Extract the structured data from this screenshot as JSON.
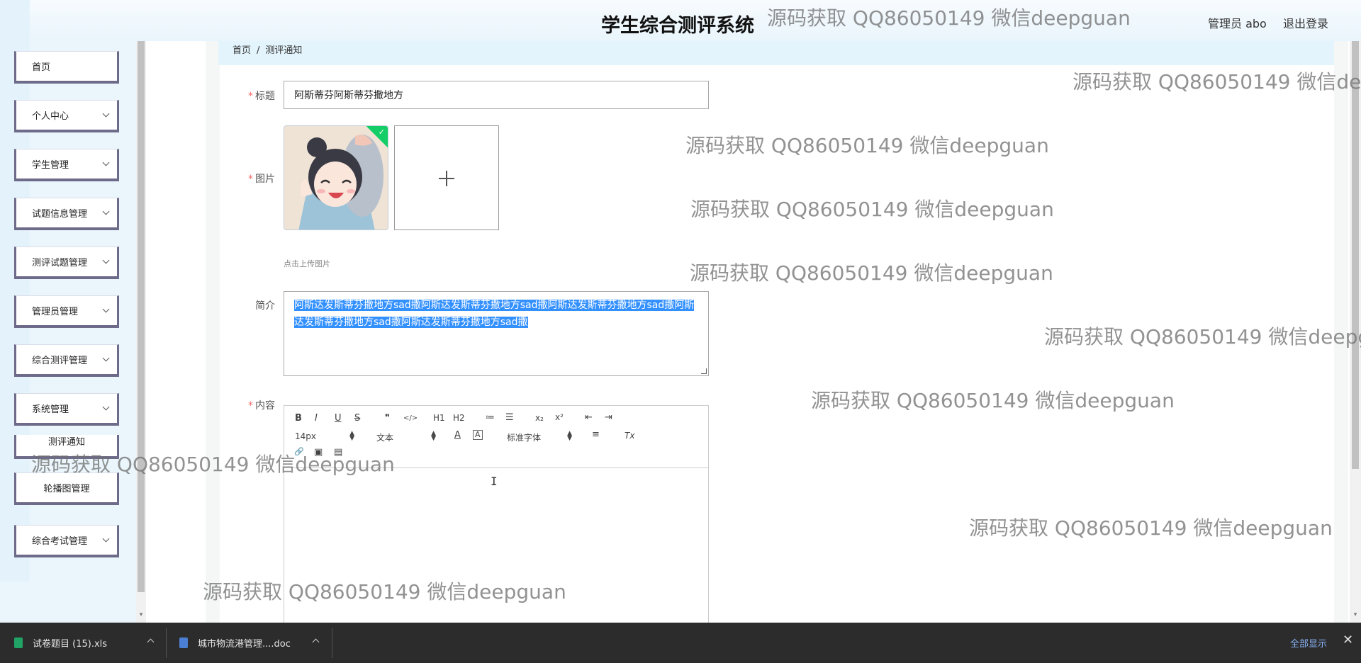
{
  "header": {
    "system_title": "学生综合测评系统",
    "user_label": "管理员 abo",
    "logout_label": "退出登录"
  },
  "sidebar": {
    "items": [
      {
        "label": "首页"
      },
      {
        "label": "个人中心"
      },
      {
        "label": "学生管理"
      },
      {
        "label": "试题信息管理"
      },
      {
        "label": "测评试题管理"
      },
      {
        "label": "管理员管理"
      },
      {
        "label": "综合测评管理"
      },
      {
        "label": "系统管理"
      },
      {
        "label": "测评通知"
      },
      {
        "label": "轮播图管理"
      },
      {
        "label": "综合考试管理"
      }
    ]
  },
  "breadcrumb": {
    "home": "首页",
    "separator": "/",
    "current": "测评通知"
  },
  "form": {
    "title_label": "标题",
    "title_value": "阿斯蒂芬阿斯蒂芬撒地方",
    "image_label": "图片",
    "upload_tip": "点击上传图片",
    "intro_label": "简介",
    "intro_value": "阿斯达发斯蒂芬撒地方sad撒阿斯达发斯蒂芬撒地方sad撒阿斯达发斯蒂芬撒地方sad撒阿斯达发斯蒂芬撒地方sad撒阿斯达发斯蒂芬撒地方sad撒",
    "content_label": "内容",
    "required_mark": "*"
  },
  "editor": {
    "font_size": "14px",
    "paragraph": "文本",
    "font_family": "标准字体",
    "buttons": {
      "bold": "B",
      "italic": "I",
      "underline": "U",
      "strike": "S",
      "quote": "❞",
      "code": "</>",
      "h1": "H1",
      "h2": "H2",
      "ordered": "≔",
      "bullet": "☰",
      "sub": "x₂",
      "sup": "x²",
      "outdent": "⇤",
      "indent": "⇥",
      "color": "A",
      "background": "A",
      "align": "≡",
      "clean": "Tx",
      "link": "🔗",
      "image": "▣",
      "video": "▤"
    }
  },
  "watermark": "源码获取 QQ86050149 微信deepguan",
  "downloads": {
    "items": [
      {
        "name": "试卷题目 (15).xls",
        "icon": "excel-icon",
        "color": "#21a366"
      },
      {
        "name": "城市物流港管理....doc",
        "icon": "word-icon",
        "color": "#4a7fd4"
      }
    ],
    "show_all": "全部显示",
    "close": "✕"
  }
}
